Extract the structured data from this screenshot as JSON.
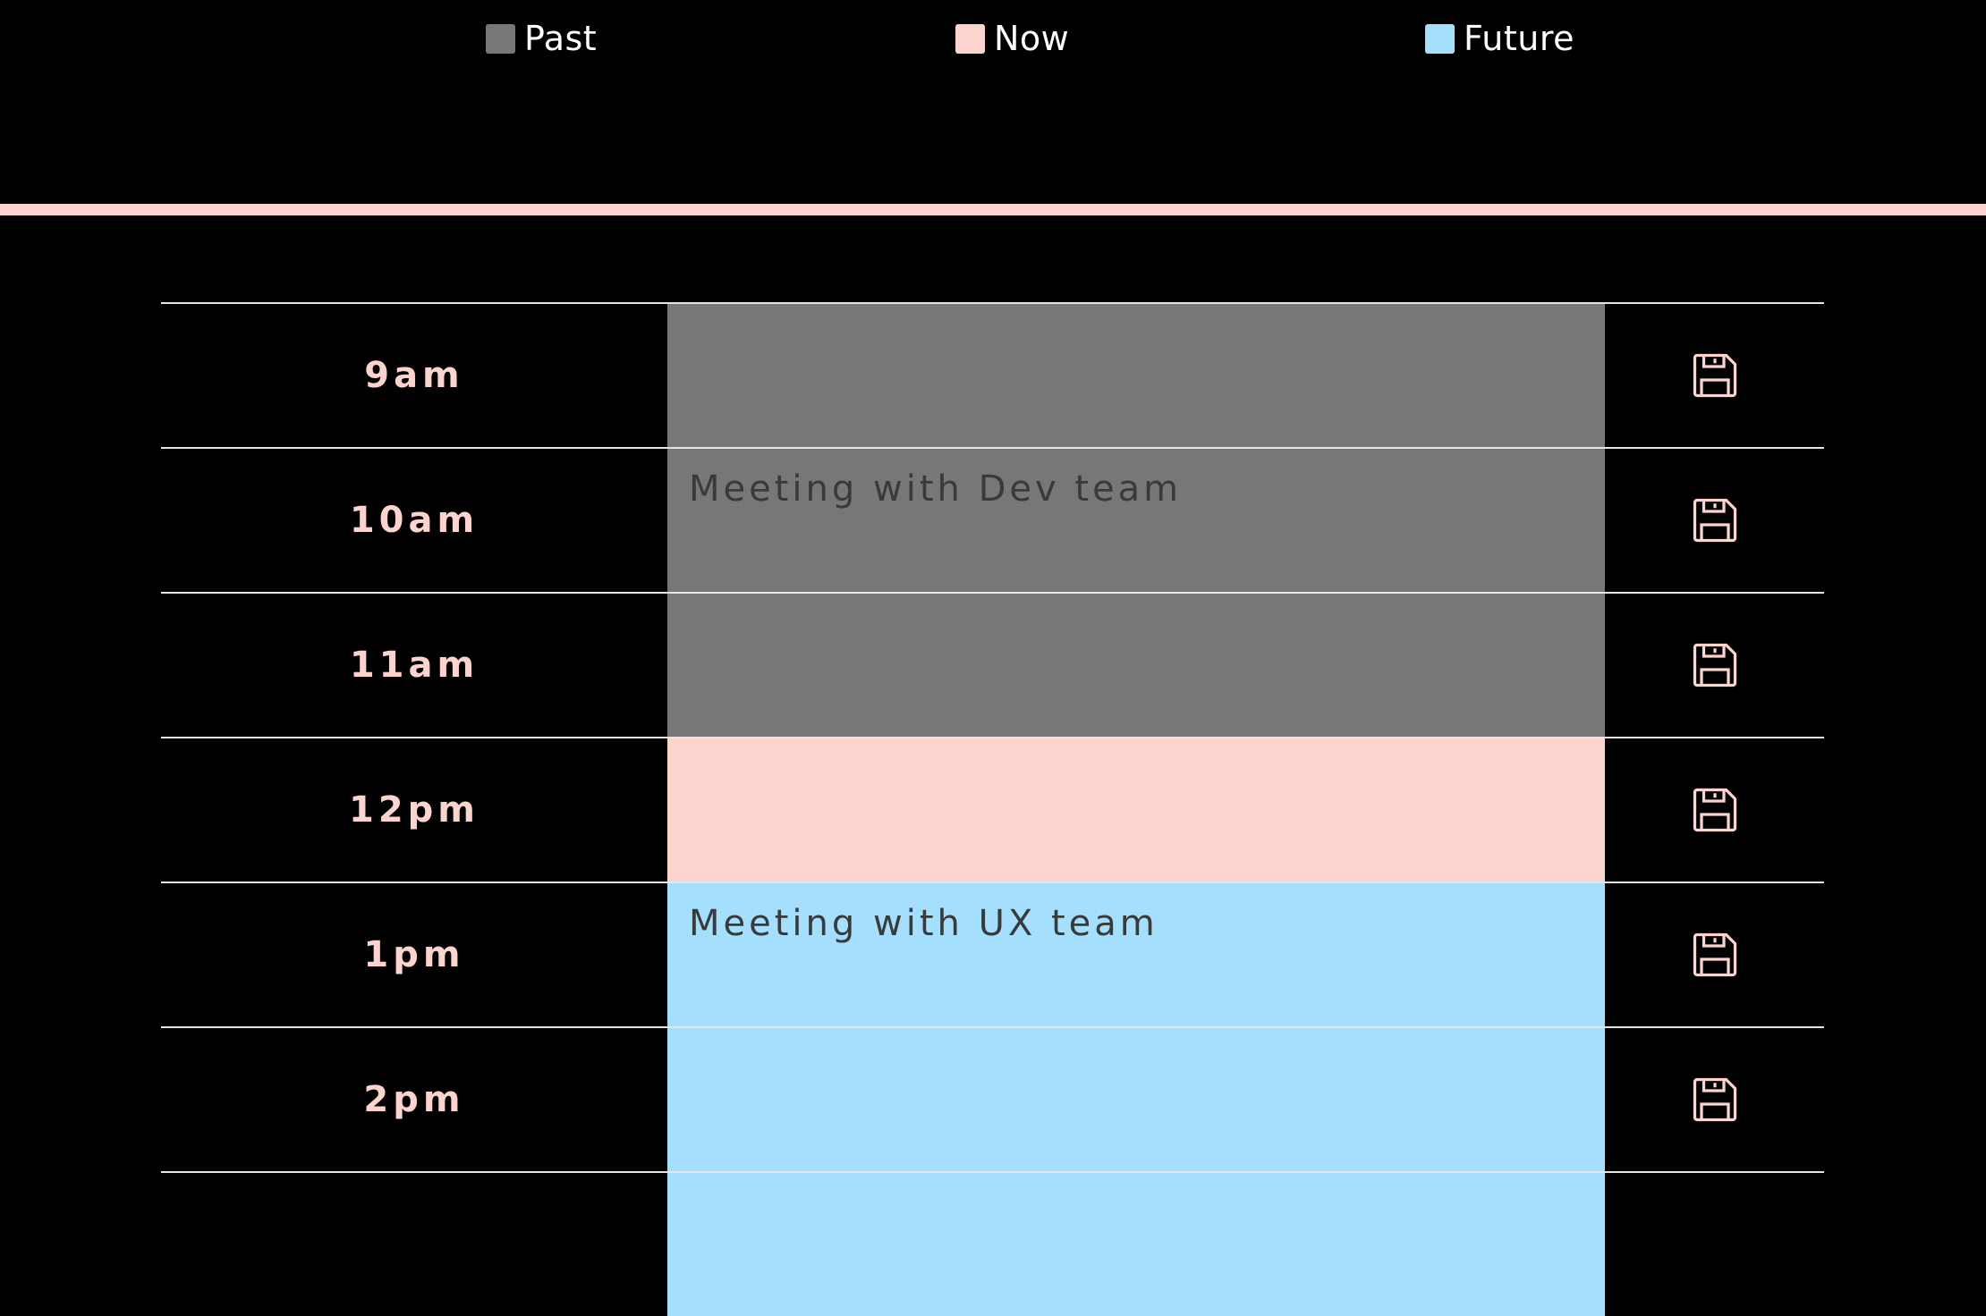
{
  "legend": [
    {
      "label": "Past",
      "color": "#777777"
    },
    {
      "label": "Now",
      "color": "#fcd4cd"
    },
    {
      "label": "Future",
      "color": "#a4e0fd"
    }
  ],
  "accent_color": "#fcd4cd",
  "rows": [
    {
      "hour": "9am",
      "text": "",
      "state": "past"
    },
    {
      "hour": "10am",
      "text": "Meeting with Dev team",
      "state": "past"
    },
    {
      "hour": "11am",
      "text": "",
      "state": "past"
    },
    {
      "hour": "12pm",
      "text": "",
      "state": "present"
    },
    {
      "hour": "1pm",
      "text": "Meeting with UX team",
      "state": "future"
    },
    {
      "hour": "2pm",
      "text": "",
      "state": "future"
    },
    {
      "hour": "",
      "text": "",
      "state": "future"
    }
  ],
  "save_icon": "floppy-disk-icon"
}
